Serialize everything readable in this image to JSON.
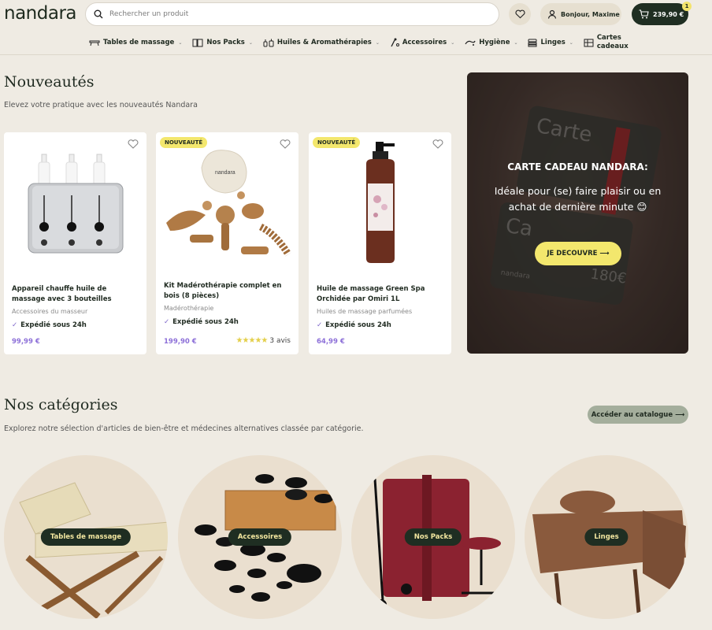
{
  "header": {
    "logo": "nandara",
    "search_placeholder": "Rechercher un produit",
    "account_label": "Bonjour, Maxime",
    "cart_total": "239,90 €",
    "cart_count": "1"
  },
  "nav": {
    "items": [
      {
        "label": "Tables de massage",
        "icon": "massage-table-icon"
      },
      {
        "label": "Nos Packs",
        "icon": "pack-icon"
      },
      {
        "label": "Huiles & Aromathérapies",
        "icon": "oil-bottles-icon"
      },
      {
        "label": "Accessoires",
        "icon": "accessories-icon"
      },
      {
        "label": "Hygiène",
        "icon": "hygiene-icon"
      },
      {
        "label": "Linges",
        "icon": "linen-icon"
      },
      {
        "label": "Cartes cadeaux",
        "icon": "gift-card-icon",
        "line1": "Cartes",
        "line2": "cadeaux"
      }
    ]
  },
  "new_section": {
    "title": "Nouveautés",
    "subtitle": "Elevez votre pratique avec les nouveautés Nandara"
  },
  "products": [
    {
      "name": "Appareil chauffe huile de massage avec 3 bouteilles",
      "category": "Accessoires du masseur",
      "shipping": "Expédié sous 24h",
      "price": "99,99 €",
      "badge": ""
    },
    {
      "name": "Kit Madérothérapie complet en bois (8 pièces)",
      "category": "Madérothérapie",
      "shipping": "Expédié sous 24h",
      "price": "199,90 €",
      "badge": "NOUVEAUTÉ",
      "rating": 5,
      "reviews": "3 avis",
      "pouch_text": "nandara"
    },
    {
      "name": "Huile de massage Green Spa Orchidée par Omiri 1L",
      "category": "Huiles de massage parfumées",
      "shipping": "Expédié sous 24h",
      "price": "64,99 €",
      "badge": "NOUVEAUTÉ"
    }
  ],
  "gift_card": {
    "title": "CARTE CADEAU NANDARA:",
    "text": "Idéale pour (se) faire plaisir ou en achat de dernière minute 😊",
    "button": "JE DECOUVRE ⟶",
    "card_word_1": "Carte",
    "card_word_2": "Ca",
    "card_amount": "180€",
    "card_brand": "nandara"
  },
  "categories_section": {
    "title": "Nos catégories",
    "subtitle": "Explorez notre sélection d'articles de bien-être et médecines alternatives classée par catégorie.",
    "catalog_button": "Accéder au catalogue ⟶",
    "items": [
      {
        "label": "Tables de massage"
      },
      {
        "label": "Accessoires"
      },
      {
        "label": "Nos Packs"
      },
      {
        "label": "Linges"
      }
    ]
  },
  "colors": {
    "background": "#efebe3",
    "dark_green": "#1f2e22",
    "yellow": "#f3e76d",
    "price_purple": "#8c6fd8"
  }
}
